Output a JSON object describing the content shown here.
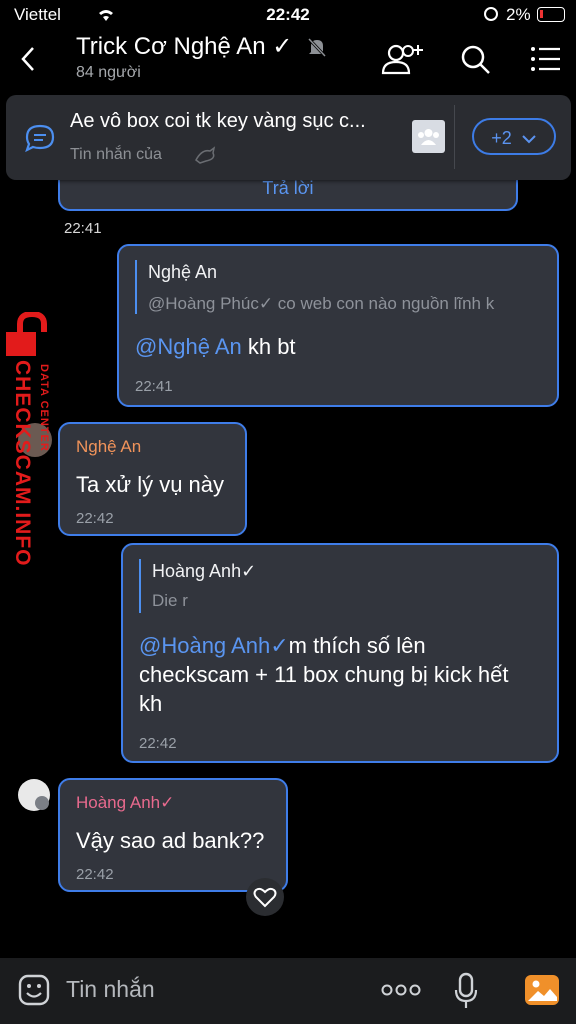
{
  "status_bar": {
    "carrier": "Viettel",
    "time": "22:42",
    "battery": "2%"
  },
  "header": {
    "title": "Trick Cơ Nghệ An ✓",
    "members": "84 người"
  },
  "pinned": {
    "text": "Ae vô box coi tk key vàng sục c...",
    "sub": "Tin nhắn của",
    "more_label": "+2"
  },
  "previous": {
    "reply_label": "Trả lời",
    "time": "22:41"
  },
  "messages": [
    {
      "quote_name": "Nghệ An",
      "quote_text": "@Hoàng Phúc✓ co web con nào nguồn lĩnh k",
      "mention": "@Nghệ An",
      "text": " kh bt",
      "time": "22:41"
    },
    {
      "sender": "Nghệ An",
      "text": "Ta xử lý vụ này",
      "time": "22:42"
    },
    {
      "quote_name": "Hoàng Anh✓",
      "quote_text": "Die r",
      "mention": "@Hoàng Anh✓",
      "text_line1": "m thích số lên",
      "text_line2": "checkscam + 11 box chung bị kick hết",
      "text_line3": "kh",
      "time": "22:42"
    },
    {
      "sender": "Hoàng Anh✓",
      "text": "Vậy sao ad bank??",
      "time": "22:42"
    }
  ],
  "input": {
    "placeholder": "Tin nhắn"
  },
  "watermark": {
    "main": "CHECKSCAM.INFO",
    "sub": "DATA CENTER"
  },
  "colors": {
    "accent": "#3f7de9",
    "bubble": "#32353d",
    "orange_name": "#f0935a",
    "pink_name": "#e86a8e"
  }
}
